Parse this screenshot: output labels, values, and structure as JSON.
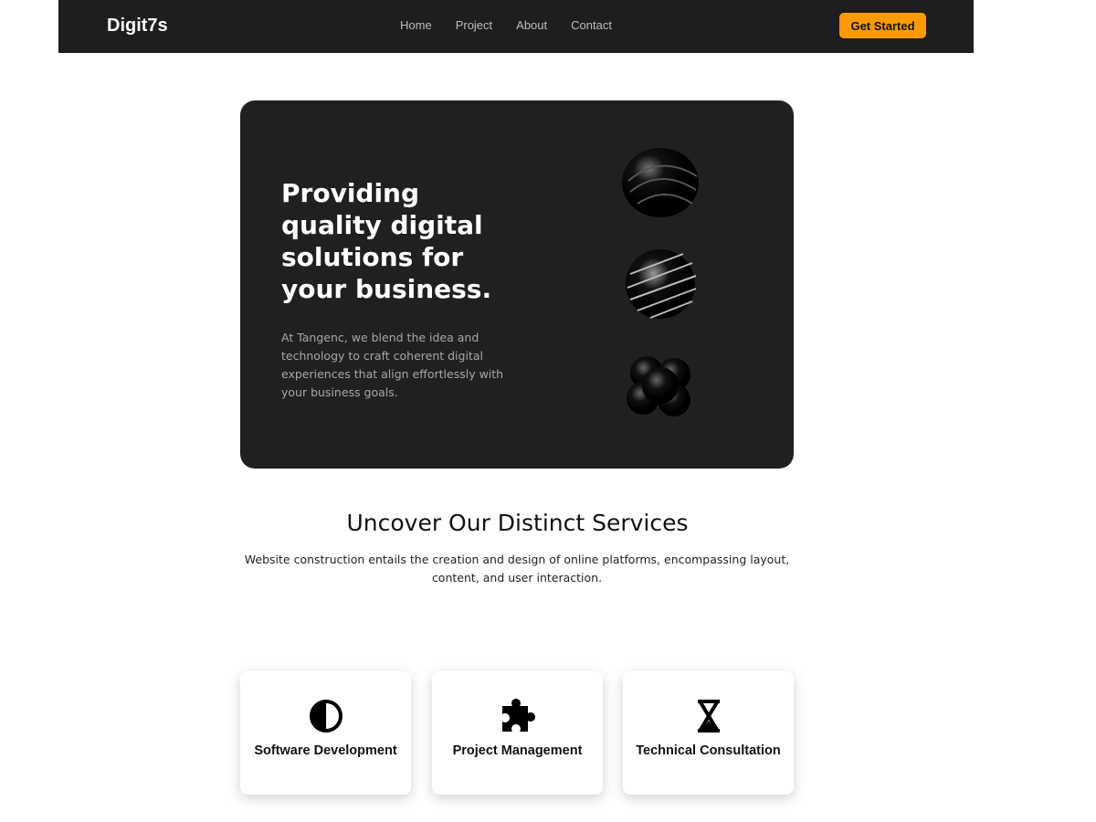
{
  "nav": {
    "logo": "Digit7s",
    "links": [
      "Home",
      "Project",
      "About",
      "Contact"
    ],
    "cta": "Get Started"
  },
  "hero": {
    "title": "Providing quality digital solutions for your business.",
    "description": "At Tangenc, we blend the idea and technology to craft coherent digital experiences that align effortlessly with your business goals."
  },
  "services": {
    "title": "Uncover Our Distinct Services",
    "description": "Website construction entails the creation and design of online platforms, encompassing layout, content, and user interaction.",
    "cards": [
      {
        "label": "Software Development",
        "icon": "half-circle-icon"
      },
      {
        "label": "Project Management",
        "icon": "puzzle-icon"
      },
      {
        "label": "Technical Consultation",
        "icon": "hourglass-icon"
      }
    ]
  }
}
